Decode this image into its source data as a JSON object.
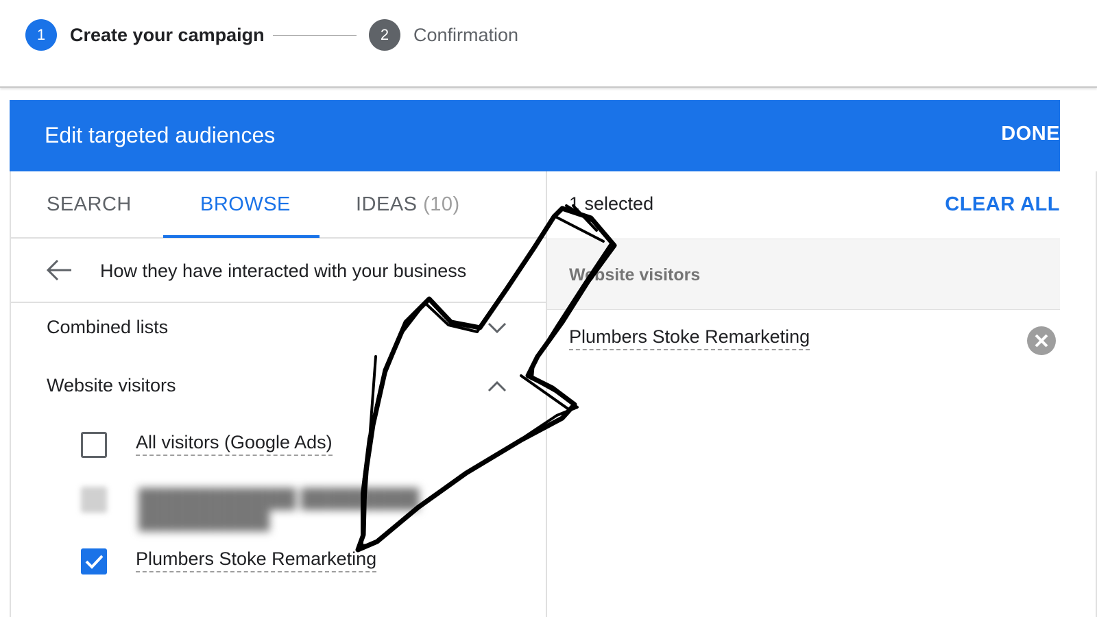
{
  "stepper": {
    "step1": {
      "number": "1",
      "label": "Create your campaign"
    },
    "step2": {
      "number": "2",
      "label": "Confirmation"
    }
  },
  "dialog": {
    "title": "Edit targeted audiences",
    "done_label": "DONE"
  },
  "tabs": {
    "search": "SEARCH",
    "browse": "BROWSE",
    "ideas": "IDEAS",
    "ideas_count": "(10)",
    "active": "BROWSE"
  },
  "browse": {
    "breadcrumb": "How they have interacted with your business",
    "categories": [
      {
        "label": "Combined lists",
        "expanded": false
      },
      {
        "label": "Website visitors",
        "expanded": true
      }
    ],
    "items": [
      {
        "label": "All visitors (Google Ads)",
        "checked": false
      },
      {
        "label": "Plumbers Stoke Remarketing",
        "checked": true
      }
    ]
  },
  "selection": {
    "count_text": "1 selected",
    "clear_all_label": "CLEAR ALL",
    "group_title": "Website visitors",
    "items": [
      {
        "label": "Plumbers Stoke Remarketing"
      }
    ]
  },
  "colors": {
    "accent": "#1a73e8",
    "step_inactive": "#5f6368",
    "annotation": "#000000"
  },
  "icons": [
    "back-arrow-icon",
    "chevron-down-icon",
    "chevron-up-icon",
    "checkmark-icon",
    "close-icon"
  ]
}
